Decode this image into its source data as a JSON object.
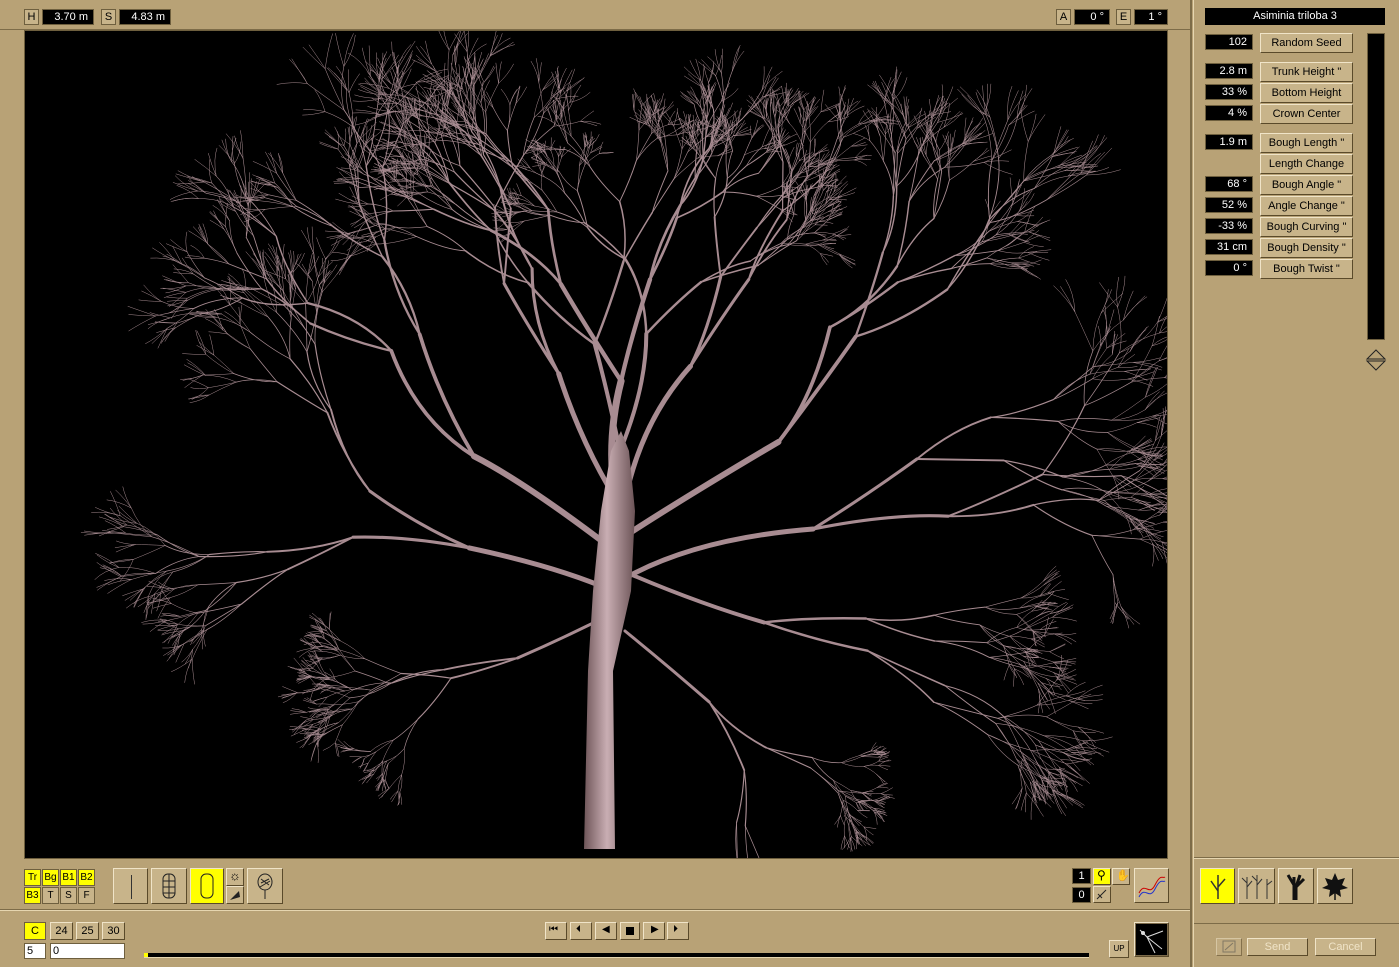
{
  "toolbar_top": {
    "h_label": "H",
    "h_value": "3.70 m",
    "s_label": "S",
    "s_value": "4.83 m",
    "a_label": "A",
    "a_value": "0 °",
    "e_label": "E",
    "e_value": "1 °"
  },
  "panel": {
    "species": "Asiminia triloba 3",
    "params": [
      {
        "value": "102",
        "label": "Random Seed"
      },
      {
        "value": "2.8 m",
        "label": "Trunk Height \""
      },
      {
        "value": "33 %",
        "label": "Bottom Height"
      },
      {
        "value": "4 %",
        "label": "Crown Center"
      },
      {
        "value": "1.9 m",
        "label": "Bough Length \""
      },
      {
        "value": "",
        "label": "Length Change"
      },
      {
        "value": "68 °",
        "label": "Bough Angle \""
      },
      {
        "value": "52 %",
        "label": "Angle Change \""
      },
      {
        "value": "-33 %",
        "label": "Bough Curving \""
      },
      {
        "value": "31 cm",
        "label": "Bough Density \""
      },
      {
        "value": "0 °",
        "label": "Bough Twist \""
      }
    ],
    "send_label": "Send",
    "cancel_label": "Cancel"
  },
  "levels": {
    "row1": [
      "Tr",
      "Bg",
      "B1",
      "B2"
    ],
    "row2": [
      "B3",
      "T",
      "S",
      "F"
    ]
  },
  "view_counters": {
    "top": "1",
    "bottom": "0"
  },
  "frames": {
    "c_label": "C",
    "buttons": [
      "24",
      "25",
      "30"
    ],
    "field_a": "5",
    "field_b": "0",
    "up_label": "UP"
  },
  "icons": {
    "accent": "#ffff00",
    "tree_color": "#a88c92",
    "viewport_bg": "#000000",
    "panel_bg": "#b8a276"
  }
}
